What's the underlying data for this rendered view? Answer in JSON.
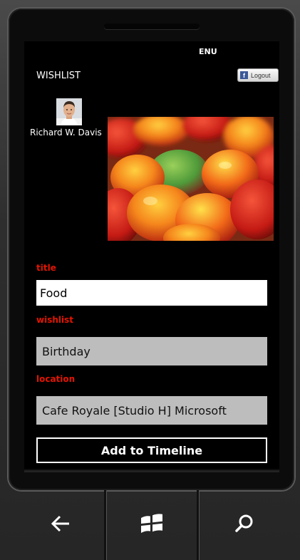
{
  "status_bar": {
    "language": "ENU"
  },
  "header": {
    "title": "WISHLIST",
    "logout_label": "Logout"
  },
  "profile": {
    "name": "Richard W. Davis"
  },
  "form": {
    "title_label": "title",
    "title_value": "Food",
    "wishlist_label": "wishlist",
    "wishlist_value": "Birthday",
    "location_label": "location",
    "location_value": "Cafe Royale [Studio H] Microsoft",
    "submit_label": "Add to Timeline"
  },
  "nav": {
    "back_icon": "back-arrow-icon",
    "start_icon": "windows-logo-icon",
    "search_icon": "search-icon"
  },
  "colors": {
    "accent_label": "#e51400",
    "field_gray": "#bdbdbd",
    "facebook": "#3b5998"
  }
}
